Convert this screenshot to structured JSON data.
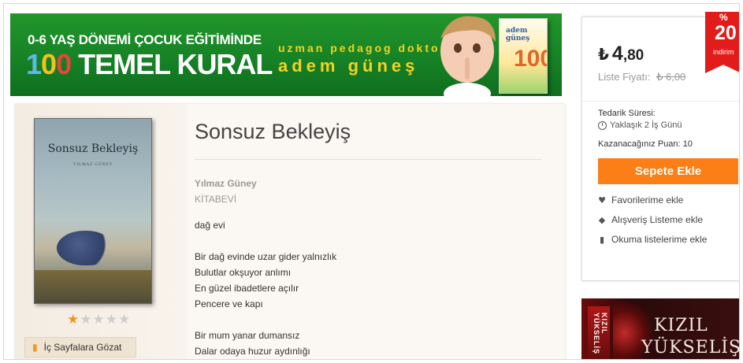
{
  "banner": {
    "line1": "0-6 YAŞ DÖNEMİ ÇOCUK EĞİTİMİNDE",
    "digit1": "1",
    "digit2": "0",
    "digit3": "0",
    "line2": " TEMEL KURAL",
    "subtitle": "uzman pedagog doktor",
    "author_name": "adem güneş",
    "mini_book_title": "adem güneş",
    "mini_book_number": "100"
  },
  "product": {
    "cover_title": "Sonsuz Bekleyiş",
    "cover_author": "YILMAZ GÜNEY",
    "title": "Sonsuz Bekleyiş",
    "author": "Yılmaz Güney",
    "publisher": "KİTABEVİ",
    "rating": {
      "value": 1,
      "max": 5
    },
    "browse_label": "İç Sayfalara Gözat",
    "description": [
      "dağ evi",
      "",
      "Bir dağ evinde uzar gider yalnızlık",
      "Bulutlar okşuyor anlımı",
      "En güzel ibadetlere açılır",
      "Pencere ve kapı",
      "",
      "Bir mum yanar dumansız",
      "Dalar odaya huzur aydınlığı"
    ]
  },
  "purchase": {
    "currency_symbol": "₺",
    "price_int": "4",
    "price_dec": ",80",
    "list_label": "Liste Fiyatı:",
    "list_price": "₺ 6,00",
    "delivery_label": "Tedarik Süresi:",
    "delivery_value": "Yaklaşık 2 İş Günü",
    "points": "Kazanacağınız Puan: 10",
    "cart_button": "Sepete Ekle",
    "actions": [
      {
        "icon": "heart-icon",
        "label": "Favorilerime ekle"
      },
      {
        "icon": "tag-icon",
        "label": "Alışveriş Listeme ekle"
      },
      {
        "icon": "book-icon",
        "label": "Okuma listelerime ekle"
      }
    ],
    "discount_badge": {
      "percent_sign": "%",
      "value": "20",
      "text": "indirim"
    }
  },
  "side_ad": {
    "spine_text": "KIZIL YÜKSELİŞ",
    "title_line1": "KIZIL",
    "title_line2": "YÜKSELİŞ"
  },
  "colors": {
    "accent_orange": "#fb7e16",
    "discount_red": "#e21b1b",
    "banner_green": "#168226"
  }
}
